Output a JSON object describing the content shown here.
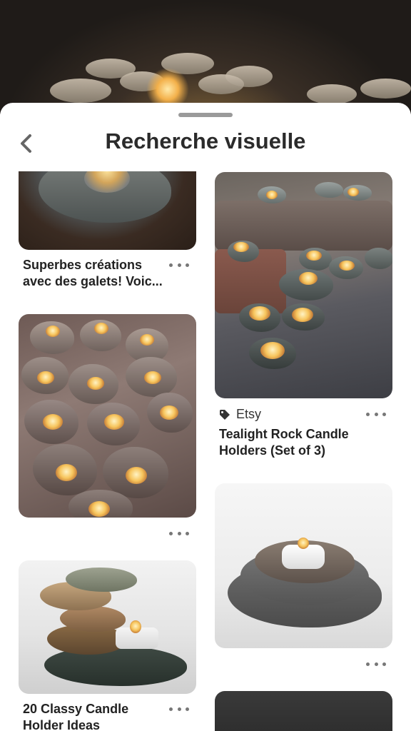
{
  "screen": {
    "title": "Recherche visuelle"
  },
  "icons": {
    "back": "chevron-left-icon",
    "more": "more-horizontal-icon",
    "tag": "tag-icon"
  },
  "pins": [
    {
      "caption": "Superbes créations avec des galets! Voic..."
    },
    {
      "caption": ""
    },
    {
      "caption": "20 Classy Candle Holder Ideas"
    },
    {
      "source": "Etsy",
      "caption": "Tealight Rock Candle Holders (Set of 3)"
    },
    {
      "caption": ""
    },
    {
      "caption": ""
    }
  ],
  "colors": {
    "text": "#222222",
    "muted": "#777777",
    "sheet": "#ffffff"
  }
}
